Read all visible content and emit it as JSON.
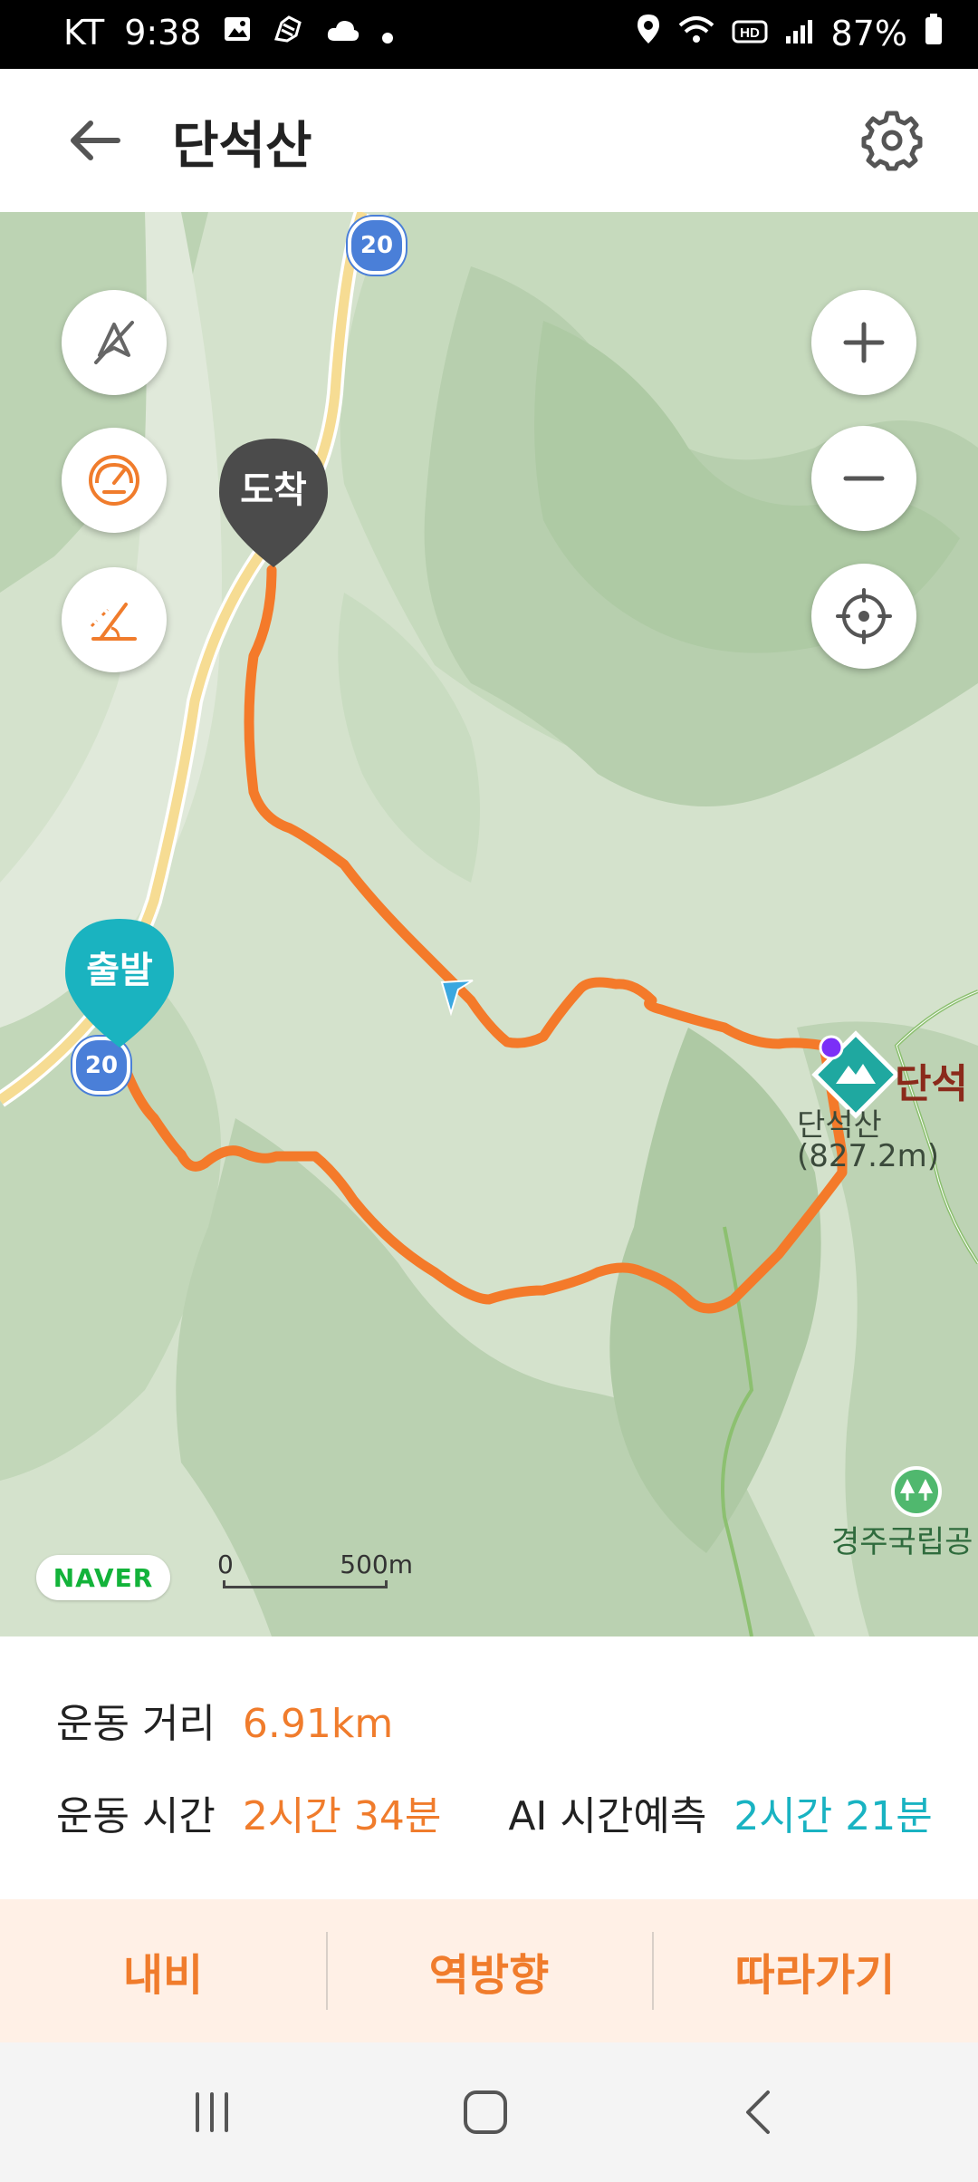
{
  "status_bar": {
    "carrier": "KT",
    "time": "9:38",
    "battery": "87%"
  },
  "app_bar": {
    "title": "단석산"
  },
  "map": {
    "start_pin": "출발",
    "end_pin": "도착",
    "route_number": "20",
    "peak_name": "단석",
    "peak_name_partial_sub": "단석산",
    "peak_elevation": "(827.2m)",
    "park_label": "경주국립공",
    "naver_logo": "NAVER",
    "scale_start": "0",
    "scale_end": "500m",
    "route_color": "#f47a2a",
    "start_color": "#1ab3c0",
    "end_color": "#4b4b4b"
  },
  "stats": {
    "distance_label": "운동 거리",
    "distance_value": "6.91km",
    "time_label": "운동 시간",
    "time_value": "2시간 34분",
    "ai_label": "AI 시간예측",
    "ai_value": "2시간 21분"
  },
  "actions": {
    "navi": "내비",
    "reverse": "역방향",
    "follow": "따라가기"
  }
}
